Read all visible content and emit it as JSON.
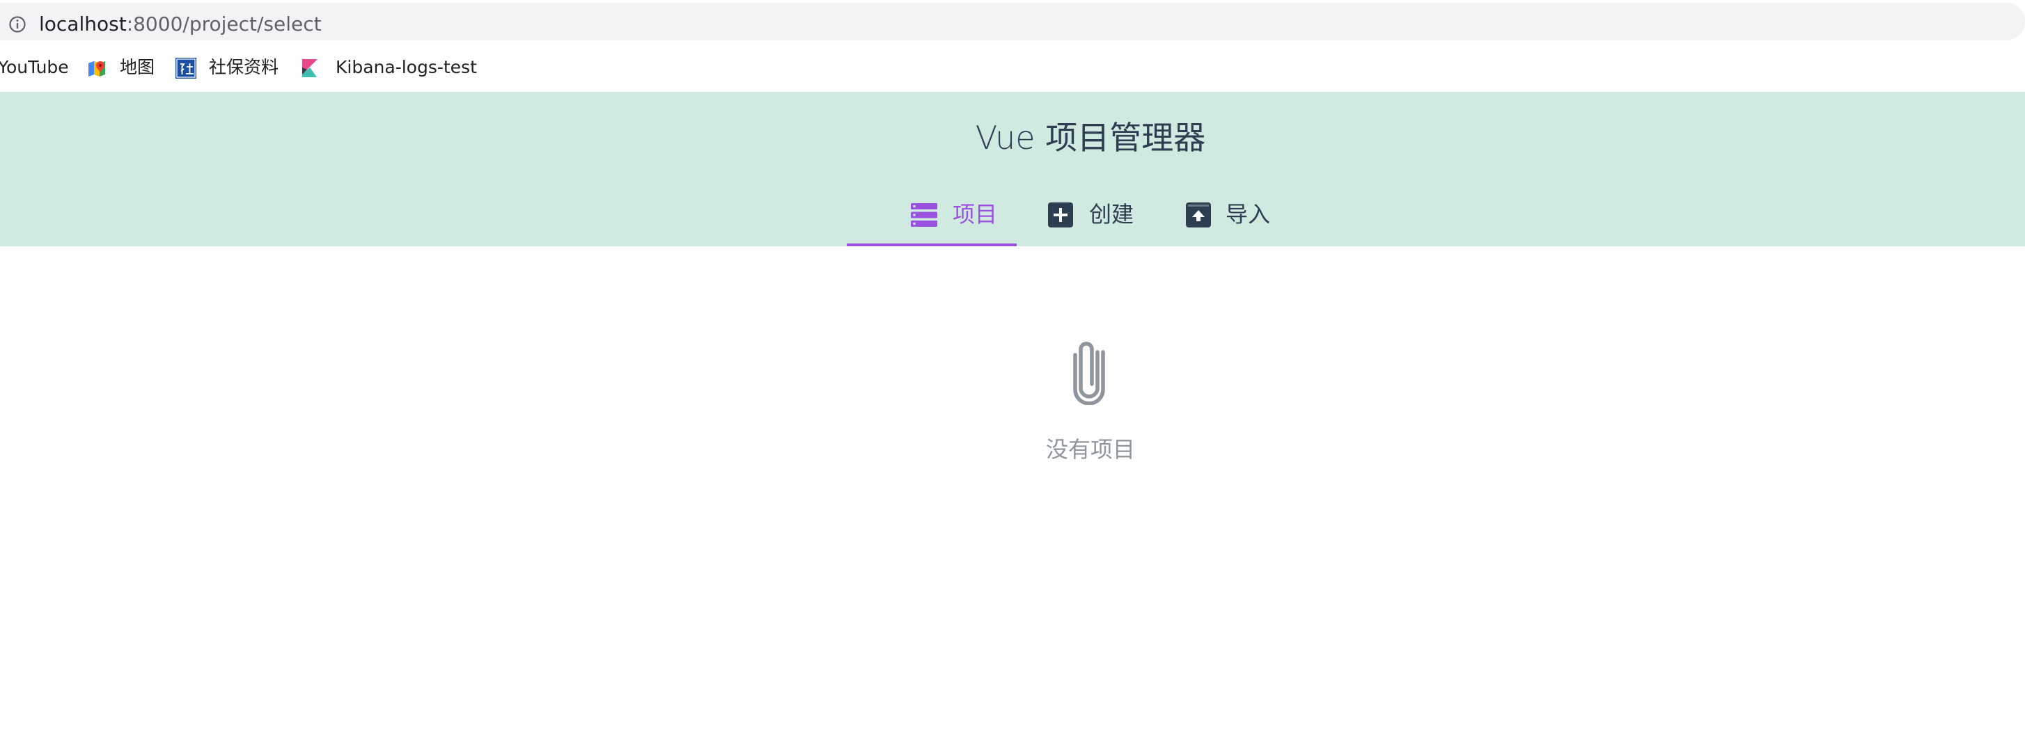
{
  "browser": {
    "url_host": "localhost",
    "url_path": ":8000/project/select",
    "info_icon": "info-circle-icon"
  },
  "bookmarks": [
    {
      "label": "YouTube",
      "icon": "none"
    },
    {
      "label": "地图",
      "icon": "google-maps-icon"
    },
    {
      "label": "社保资料",
      "icon": "she-character-icon"
    },
    {
      "label": "Kibana-logs-test",
      "icon": "kibana-icon"
    }
  ],
  "app": {
    "title": "Vue 项目管理器",
    "header_color": "#d0eae1",
    "accent_color": "#9b51e0",
    "tabs": [
      {
        "label": "项目",
        "icon": "list-icon",
        "active": true
      },
      {
        "label": "创建",
        "icon": "plus-square-icon",
        "active": false
      },
      {
        "label": "导入",
        "icon": "unarchive-icon",
        "active": false
      }
    ]
  },
  "empty_state": {
    "icon": "paperclip-icon",
    "text": "没有项目"
  }
}
